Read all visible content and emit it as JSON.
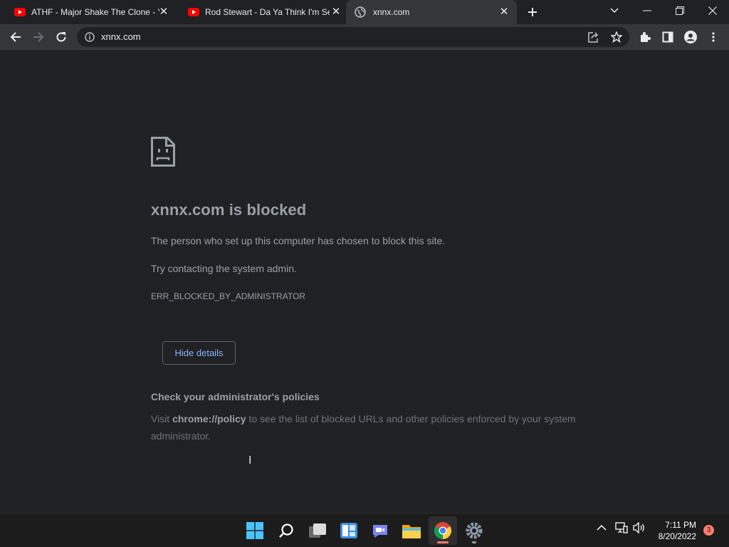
{
  "tabs": [
    {
      "title": "ATHF - Major Shake The Clone - Y",
      "icon": "youtube-icon"
    },
    {
      "title": "Rod Stewart - Da Ya Think I'm Sexy",
      "icon": "youtube-icon"
    },
    {
      "title": "xnnx.com",
      "icon": "globe-icon",
      "active": true
    }
  ],
  "toolbar": {
    "url": "xnnx.com"
  },
  "page": {
    "heading": "xnnx.com is blocked",
    "message": "The person who set up this computer has chosen to block this site.",
    "suggestion": "Try contacting the system admin.",
    "error_code": "ERR_BLOCKED_BY_ADMINISTRATOR",
    "button_label": "Hide details",
    "details_heading": "Check your administrator's policies",
    "details_prefix": "Visit ",
    "details_link": "chrome://policy",
    "details_suffix": " to see the list of blocked URLs and other policies enforced by your system administrator."
  },
  "taskbar": {
    "apps": [
      "windows-start-icon",
      "search-icon",
      "task-view-icon",
      "widgets-icon",
      "teams-chat-icon",
      "file-explorer-icon",
      "chrome-icon",
      "settings-icon"
    ],
    "time": "7:11 PM",
    "date": "8/20/2022",
    "notification_count": "3"
  },
  "colors": {
    "background": "#202124",
    "text": "#9aa0a6",
    "button_text": "#8ab4f8",
    "accent": "#ff7b6e"
  }
}
